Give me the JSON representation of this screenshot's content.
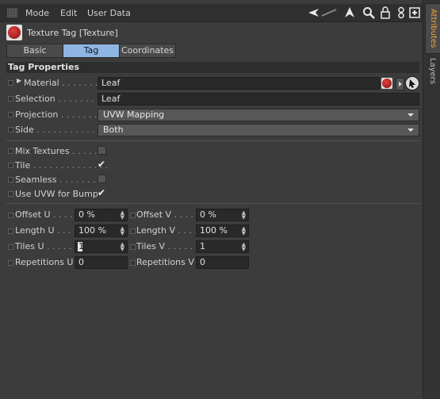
{
  "menubar": {
    "mode": "Mode",
    "edit": "Edit",
    "user_data": "User Data"
  },
  "icons": {
    "left": "arrow-left-icon",
    "up": "arrow-up-icon",
    "search": "search-icon",
    "lock": "lock-icon",
    "link": "link-icon",
    "new": "new-panel-icon"
  },
  "header": {
    "title": "Texture Tag [Texture]"
  },
  "tabs": [
    {
      "label": "Basic"
    },
    {
      "label": "Tag"
    },
    {
      "label": "Coordinates"
    }
  ],
  "section": {
    "title": "Tag Properties"
  },
  "properties": {
    "material": {
      "label": "Material",
      "value": "Leaf"
    },
    "selection": {
      "label": "Selection",
      "value": "Leaf"
    },
    "projection": {
      "label": "Projection",
      "value": "UVW Mapping"
    },
    "side": {
      "label": "Side",
      "value": "Both"
    }
  },
  "toggles": {
    "mix_textures": {
      "label": "Mix Textures",
      "checked": false
    },
    "tile": {
      "label": "Tile",
      "checked": true
    },
    "seamless": {
      "label": "Seamless",
      "checked": false
    },
    "use_uvw_bump": {
      "label": "Use UVW for Bump",
      "checked": true
    }
  },
  "numbers": {
    "offset_u": {
      "label": "Offset U",
      "value": "0 %"
    },
    "offset_v": {
      "label": "Offset V",
      "value": "0 %"
    },
    "length_u": {
      "label": "Length U",
      "value": "100 %"
    },
    "length_v": {
      "label": "Length V",
      "value": "100 %"
    },
    "tiles_u": {
      "label": "Tiles U",
      "value": "1"
    },
    "tiles_v": {
      "label": "Tiles V",
      "value": "1"
    },
    "repetitions_u": {
      "label": "Repetitions U",
      "value": "0"
    },
    "repetitions_v": {
      "label": "Repetitions V",
      "value": "0"
    }
  },
  "sidebar": {
    "tabs": [
      {
        "label": "Attributes"
      },
      {
        "label": "Layers"
      }
    ]
  },
  "colors": {
    "accent_tab": "#8fb5e3",
    "sidebar_active": "#f2a33a"
  }
}
